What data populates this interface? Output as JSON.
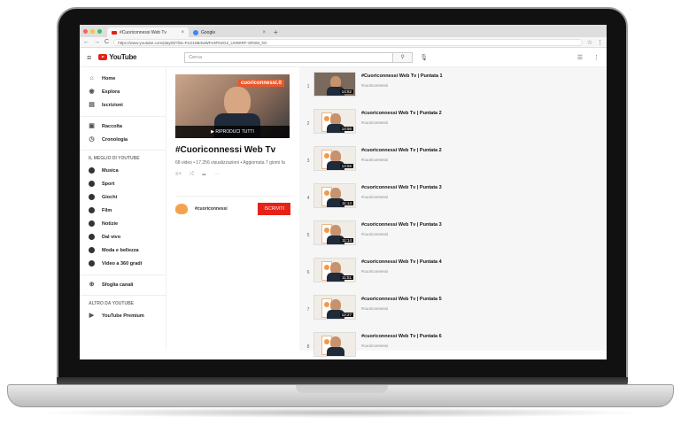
{
  "browser": {
    "tabs": [
      {
        "label": "#Cuoriconnessi Web Tv",
        "active": true
      },
      {
        "label": "Google",
        "active": false
      }
    ],
    "url": "https://www.youtube.com/playlist?list=PLD15BrtwWFe3FN2G2_UHWIRF-SRSM_hG"
  },
  "youtube": {
    "logo": "YouTube",
    "search_placeholder": "Cerca"
  },
  "sidebar": {
    "top": [
      {
        "label": "Home",
        "icon": "home-icon"
      },
      {
        "label": "Esplora",
        "icon": "explore-icon"
      },
      {
        "label": "Iscrizioni",
        "icon": "subscriptions-icon"
      }
    ],
    "library": [
      {
        "label": "Raccolta",
        "icon": "library-icon"
      },
      {
        "label": "Cronologia",
        "icon": "history-icon"
      }
    ],
    "best_header": "IL MEGLIO DI YOUTUBE",
    "best": [
      {
        "label": "Musica"
      },
      {
        "label": "Sport"
      },
      {
        "label": "Giochi"
      },
      {
        "label": "Film"
      },
      {
        "label": "Notizie"
      },
      {
        "label": "Dal vivo"
      },
      {
        "label": "Moda e bellezza"
      },
      {
        "label": "Video a 360 gradi"
      }
    ],
    "browse": "Sfoglia canali",
    "more_header": "ALTRO DA YOUTUBE",
    "more": [
      {
        "label": "YouTube Premium"
      }
    ]
  },
  "playlist": {
    "thumb_banner": "cuoriconnessi.it",
    "play_all": "▶  RIPRODUCI TUTTI",
    "title": "#Cuoriconnessi Web Tv",
    "meta": "68 video • 17.256 visualizzazioni • Aggiornata 7 giorni fa",
    "owner": "#cuoriconnessi",
    "subscribe": "ISCRIVITI"
  },
  "videos": [
    {
      "n": "1",
      "title": "#Cuoriconnessi Web Tv | Puntata 1",
      "channel": "#cuoriconnessi",
      "duration": "14:52"
    },
    {
      "n": "2",
      "title": "#cuoriconnessi Web Tv | Puntata 2",
      "channel": "#cuoriconnessi",
      "duration": "14:56"
    },
    {
      "n": "3",
      "title": "#cuoriconnessi Web Tv | Puntata 2",
      "channel": "#cuoriconnessi",
      "duration": "14:56"
    },
    {
      "n": "4",
      "title": "#cuoriconnessi Web Tv | Puntata 3",
      "channel": "#cuoriconnessi",
      "duration": "11:14"
    },
    {
      "n": "5",
      "title": "#cuoriconnessi Web Tv | Puntata 3",
      "channel": "#cuoriconnessi",
      "duration": "11:14"
    },
    {
      "n": "6",
      "title": "#cuoriconnessi Web Tv | Puntata 4",
      "channel": "#cuoriconnessi",
      "duration": "11:51"
    },
    {
      "n": "7",
      "title": "#cuoriconnessi Web Tv | Puntata 5",
      "channel": "#cuoriconnessi",
      "duration": "12:27"
    },
    {
      "n": "8",
      "title": "#cuoriconnessi Web Tv | Puntata 6",
      "channel": "#cuoriconnessi",
      "duration": ""
    }
  ]
}
